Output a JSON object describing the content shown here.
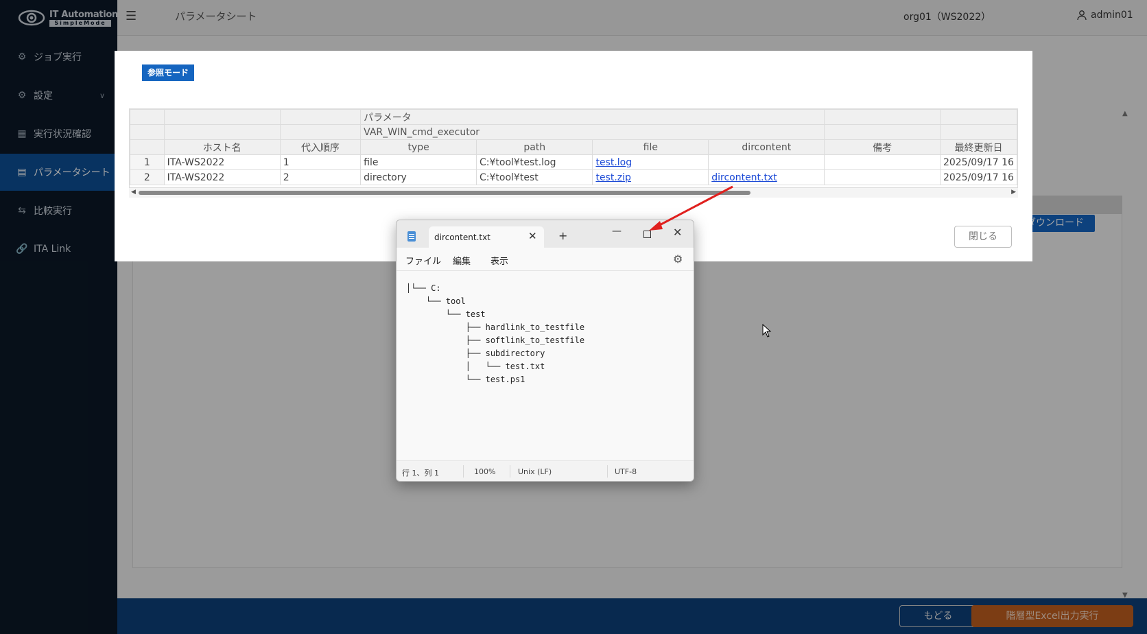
{
  "app": {
    "logo_title": "IT Automation",
    "logo_subtitle": "SimpleMode",
    "header_title": "パラメータシート",
    "org": "org01（WS2022）",
    "user": "admin01"
  },
  "sidebar": {
    "items": [
      {
        "label": "ジョブ実行",
        "icon": "gear-icon"
      },
      {
        "label": "設定",
        "icon": "settings-icon",
        "chevron": "∨"
      },
      {
        "label": "実行状況確認",
        "icon": "grid-icon"
      },
      {
        "label": "パラメータシート",
        "icon": "document-icon",
        "active": true
      },
      {
        "label": "比較実行",
        "icon": "compare-icon"
      },
      {
        "label": "ITA Link",
        "icon": "link-icon"
      }
    ]
  },
  "background": {
    "download_label": "ダウンロード"
  },
  "footer": {
    "back_label": "もどる",
    "excel_label": "階層型Excel出力実行"
  },
  "modal": {
    "mode_badge": "参照モード",
    "close_label": "閉じる",
    "table": {
      "group_header_1": "パラメータ",
      "group_header_2": "VAR_WIN_cmd_executor",
      "columns": [
        "ホスト名",
        "代入順序",
        "type",
        "path",
        "file",
        "dircontent",
        "備考",
        "最終更新日"
      ],
      "rows": [
        {
          "num": "1",
          "host": "ITA-WS2022",
          "order": "1",
          "type": "file",
          "path": "C:¥tool¥test.log",
          "file": "test.log",
          "dircontent": "",
          "note": "",
          "updated": "2025/09/17 16"
        },
        {
          "num": "2",
          "host": "ITA-WS2022",
          "order": "2",
          "type": "directory",
          "path": "C:¥tool¥test",
          "file": "test.zip",
          "dircontent": "dircontent.txt",
          "note": "",
          "updated": "2025/09/17 16"
        }
      ]
    }
  },
  "notepad": {
    "tab_title": "dircontent.txt",
    "menu": [
      "ファイル",
      "編集",
      "表示"
    ],
    "content": "│└── C:\n    └── tool\n        └── test\n            ├── hardlink_to_testfile\n            ├── softlink_to_testfile\n            ├── subdirectory\n            │   └── test.txt\n            └── test.ps1",
    "status": {
      "position": "行 1、列 1",
      "zoom": "100%",
      "line_ending": "Unix (LF)",
      "encoding": "UTF-8"
    }
  },
  "colors": {
    "sidebar_bg": "#0b1827",
    "accent_blue": "#1565c0",
    "excel_orange": "#bf5e1f",
    "annotation_red": "#e0201e"
  }
}
